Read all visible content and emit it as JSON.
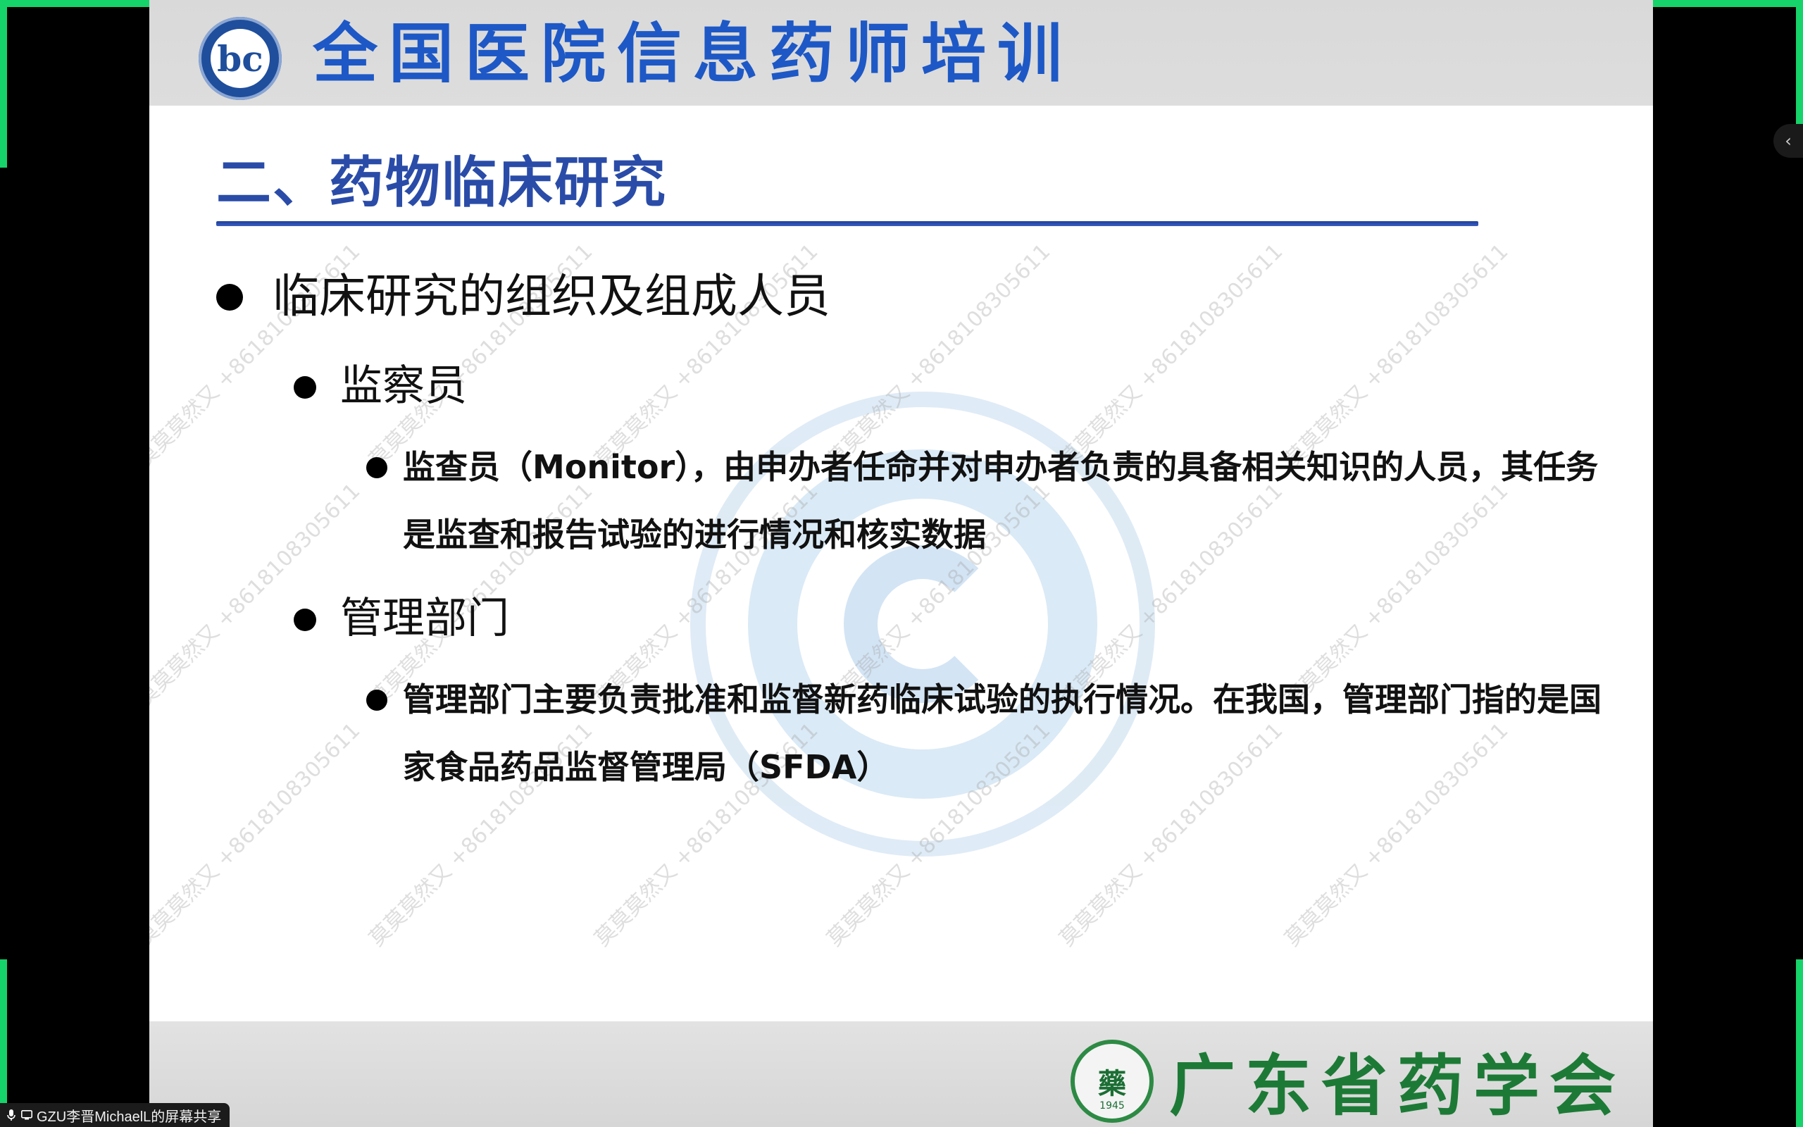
{
  "slide": {
    "banner_title": "全国医院信息药师培训",
    "banner_logo_mark": "bc",
    "title": "二、药物临床研究",
    "bullets": {
      "level1": "临床研究的组织及组成人员",
      "section1_heading": "监察员",
      "section1_text": "监查员（Monitor），由申办者任命并对申办者负责的具备相关知识的人员，其任务是监查和报告试验的进行情况和核实数据",
      "section2_heading": "管理部门",
      "section2_text": "管理部门主要负责批准和监督新药临床试验的执行情况。在我国，管理部门指的是国家食品药品监督管理局（SFDA）"
    },
    "footer_society": "广东省药学会",
    "footer_logo_glyph": "藥",
    "footer_logo_year": "1945",
    "watermark_text": "莫莫莫然又 +8618108305611"
  },
  "share_status": {
    "label": "GZU李晋MichaelL的屏幕共享",
    "icons": [
      "microphone-icon",
      "screen-share-icon"
    ]
  },
  "side_panel": {
    "toggle_icon": "chevron-left-icon",
    "toggle_glyph": "‹"
  },
  "colors": {
    "accent_frame": "#16d36a",
    "banner_blue": "#1d58c6",
    "title_blue": "#2a4ca8",
    "society_green": "#1d7a36"
  }
}
